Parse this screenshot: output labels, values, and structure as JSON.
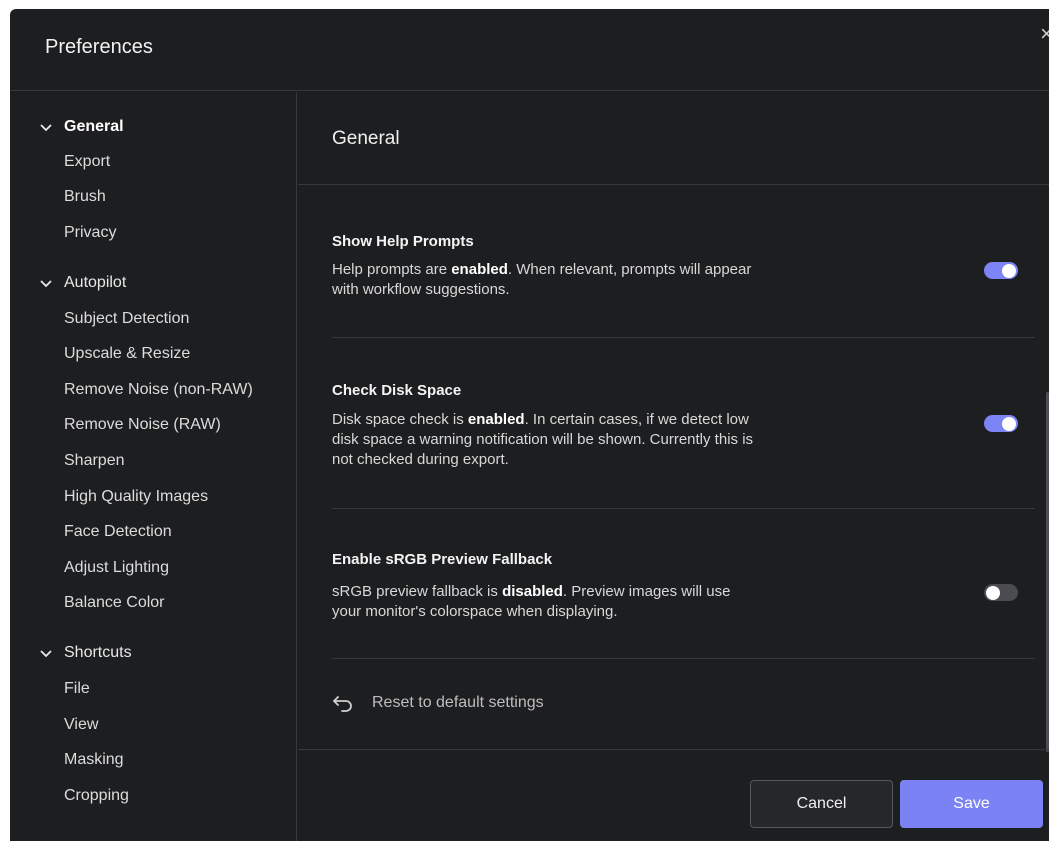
{
  "dialog": {
    "title": "Preferences",
    "close_glyph": "×"
  },
  "sidebar": {
    "groups": [
      {
        "label": "General",
        "expanded": true,
        "active": true,
        "items": [
          "Export",
          "Brush",
          "Privacy"
        ]
      },
      {
        "label": "Autopilot",
        "expanded": true,
        "active": false,
        "items": [
          "Subject Detection",
          "Upscale & Resize",
          "Remove Noise (non-RAW)",
          "Remove Noise (RAW)",
          "Sharpen",
          "High Quality Images",
          "Face Detection",
          "Adjust Lighting",
          "Balance Color"
        ]
      },
      {
        "label": "Shortcuts",
        "expanded": true,
        "active": false,
        "items": [
          "File",
          "View",
          "Masking",
          "Cropping"
        ]
      }
    ]
  },
  "content": {
    "heading": "General",
    "settings": [
      {
        "title": "Show Help Prompts",
        "desc_pre": "Help prompts are ",
        "desc_bold": "enabled",
        "desc_post": ". When relevant, prompts will appear with workflow suggestions.",
        "enabled": true
      },
      {
        "title": "Check Disk Space",
        "desc_pre": "Disk space check is ",
        "desc_bold": "enabled",
        "desc_post": ". In certain cases, if we detect low disk space a warning notification will be shown. Currently this is not checked during export.",
        "enabled": true
      },
      {
        "title": "Enable sRGB Preview Fallback",
        "desc_pre": "sRGB preview fallback is ",
        "desc_bold": "disabled",
        "desc_post": ". Preview images will use your monitor's colorspace when displaying.",
        "enabled": false
      }
    ],
    "reset_label": "Reset to default settings"
  },
  "footer": {
    "cancel_label": "Cancel",
    "save_label": "Save"
  },
  "colors": {
    "accent": "#7b83f4",
    "background": "#1d1e20",
    "divider": "#36383b"
  },
  "icons": {
    "group_chevron": "chevron-down-icon",
    "reset": "undo-arrow-icon",
    "close": "close-icon"
  }
}
